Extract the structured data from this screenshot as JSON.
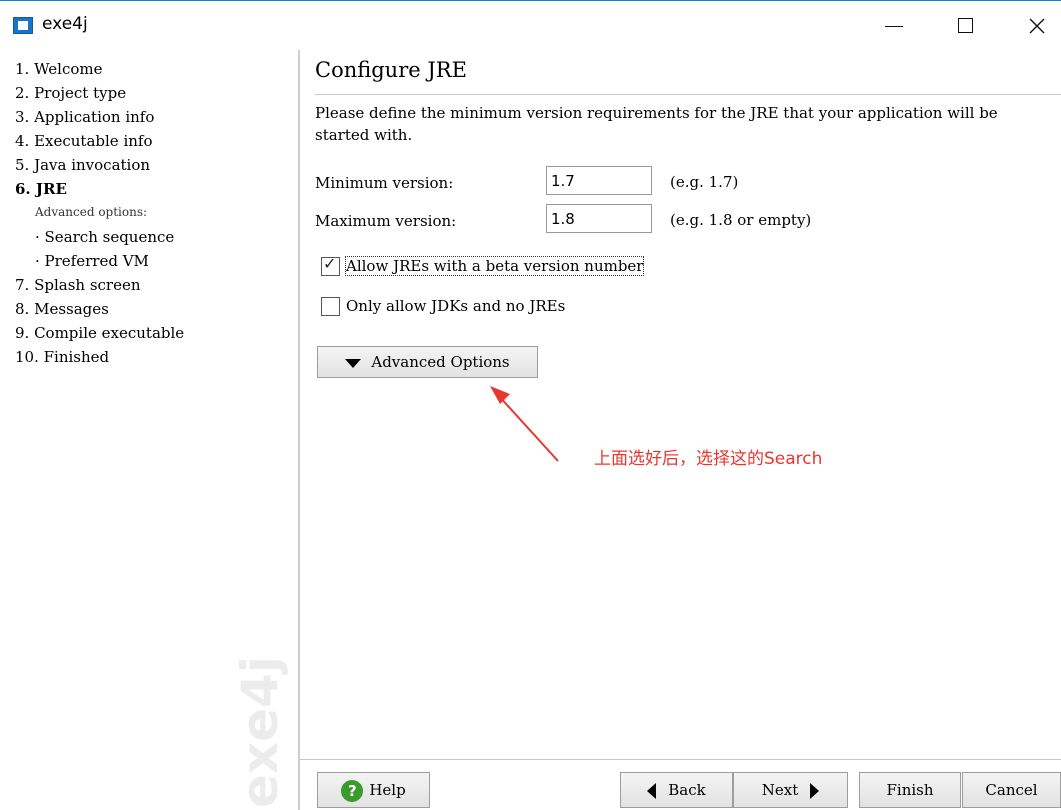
{
  "window": {
    "title": "exe4j",
    "controls": {
      "minimize": "minimize",
      "maximize": "maximize",
      "close": "close"
    }
  },
  "sidebar": {
    "items": [
      {
        "label": "1. Welcome"
      },
      {
        "label": "2. Project type"
      },
      {
        "label": "3. Application info"
      },
      {
        "label": "4. Executable info"
      },
      {
        "label": "5. Java invocation"
      },
      {
        "label": "6. JRE",
        "active": true
      }
    ],
    "advanced_label": "Advanced options:",
    "sub_items": [
      {
        "label": "· Search sequence"
      },
      {
        "label": "· Preferred VM"
      }
    ],
    "items_after": [
      {
        "label": "7. Splash screen"
      },
      {
        "label": "8. Messages"
      },
      {
        "label": "9. Compile executable"
      },
      {
        "label": "10. Finished"
      }
    ],
    "watermark": "exe4j"
  },
  "main": {
    "title": "Configure JRE",
    "description": "Please define the minimum version requirements for the JRE that your application will be started with.",
    "min_version": {
      "label": "Minimum version:",
      "value": "1.7",
      "hint": "(e.g. 1.7)"
    },
    "max_version": {
      "label": "Maximum version:",
      "value": "1.8",
      "hint": "(e.g. 1.8 or empty)"
    },
    "allow_beta": {
      "label": "Allow JREs with a beta version number",
      "checked": true
    },
    "only_jdks": {
      "label": "Only allow JDKs and no JREs",
      "checked": false
    },
    "advanced_button": "Advanced Options",
    "annotation": "上面选好后，选择这的Search"
  },
  "footer": {
    "help": "Help",
    "back": "Back",
    "next": "Next",
    "finish": "Finish",
    "cancel": "Cancel"
  },
  "colors": {
    "annotation": "#e8372f",
    "help_icon": "#3a9a2b",
    "titlebar_accent": "#1e7fd0"
  }
}
